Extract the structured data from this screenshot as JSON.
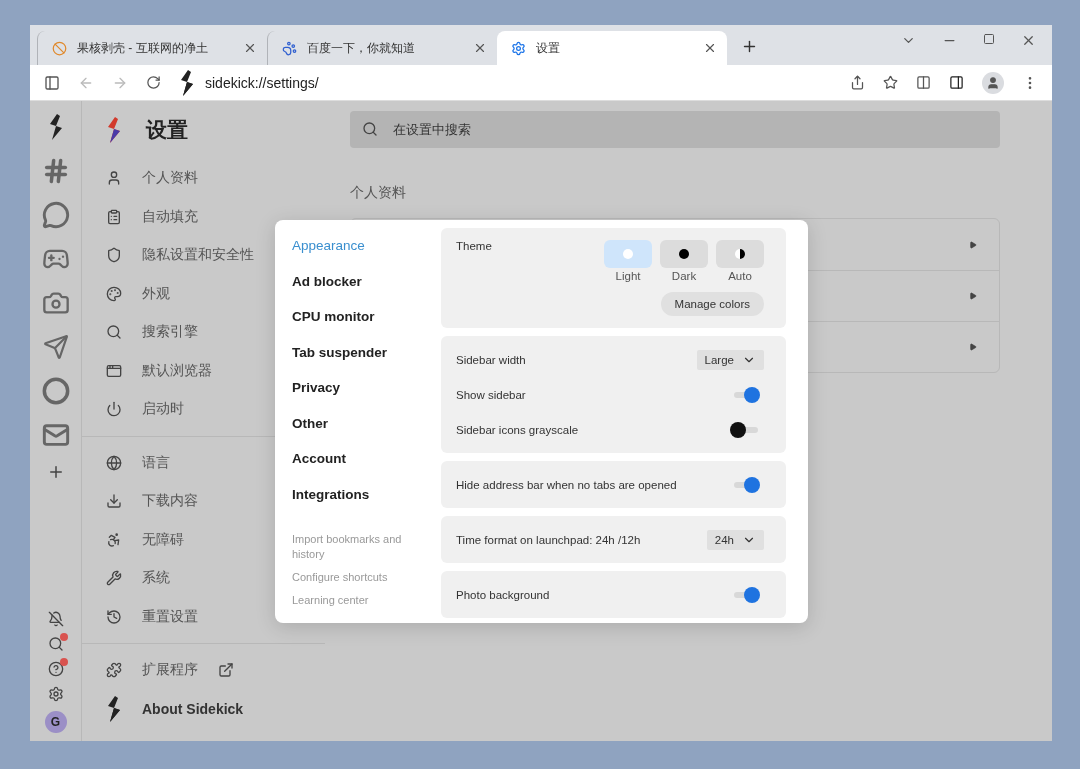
{
  "tabs": [
    {
      "title": "果核剥壳 - 互联网的净土",
      "selected": false
    },
    {
      "title": "百度一下，你就知道",
      "selected": false
    },
    {
      "title": "设置",
      "selected": true
    }
  ],
  "address": "sidekick://settings/",
  "rail": {
    "apps": [
      {
        "selected": true
      },
      {
        "selected": false
      },
      {
        "selected": false
      },
      {
        "selected": false
      },
      {
        "selected": false
      },
      {
        "selected": false
      },
      {
        "selected": false
      },
      {
        "selected": false
      }
    ],
    "tools": [
      {
        "badge": false
      },
      {
        "badge": true
      },
      {
        "badge": true
      },
      {
        "badge": false
      }
    ],
    "avatar": "G"
  },
  "settings_nav": {
    "title": "设置",
    "groups": [
      [
        "个人资料",
        "自动填充",
        "隐私设置和安全性",
        "外观",
        "搜索引擎",
        "默认浏览器",
        "启动时"
      ],
      [
        "语言",
        "下载内容",
        "无障碍",
        "系统",
        "重置设置"
      ]
    ],
    "extensions": "扩展程序",
    "about": "About Sidekick"
  },
  "search": {
    "placeholder": "在设置中搜索"
  },
  "section_heading": "个人资料",
  "dialog": {
    "nav": [
      {
        "label": "Appearance",
        "selected": true
      },
      {
        "label": "Ad blocker",
        "selected": false
      },
      {
        "label": "CPU monitor",
        "selected": false
      },
      {
        "label": "Tab suspender",
        "selected": false
      },
      {
        "label": "Privacy",
        "selected": false
      },
      {
        "label": "Other",
        "selected": false
      },
      {
        "label": "Account",
        "selected": false
      },
      {
        "label": "Integrations",
        "selected": false
      }
    ],
    "links": [
      "Import bookmarks and history",
      "Configure shortcuts",
      "Learning center"
    ],
    "cards": [
      [
        {
          "kind": "theme",
          "label": "Theme",
          "options": [
            {
              "label": "Light",
              "selected": true
            },
            {
              "label": "Dark",
              "selected": false
            },
            {
              "label": "Auto",
              "selected": false
            }
          ],
          "button": "Manage colors"
        }
      ],
      [
        {
          "kind": "select",
          "label": "Sidebar width",
          "value": "Large"
        },
        {
          "kind": "toggle",
          "label": "Show sidebar",
          "on": true
        },
        {
          "kind": "toggle",
          "label": "Sidebar icons grayscale",
          "on": false
        }
      ],
      [
        {
          "kind": "toggle",
          "label": "Hide address bar when no tabs are opened",
          "on": true
        }
      ],
      [
        {
          "kind": "select",
          "label": "Time format on launchpad: 24h /12h",
          "value": "24h"
        }
      ],
      [
        {
          "kind": "toggle",
          "label": "Photo background",
          "on": true
        }
      ]
    ]
  }
}
